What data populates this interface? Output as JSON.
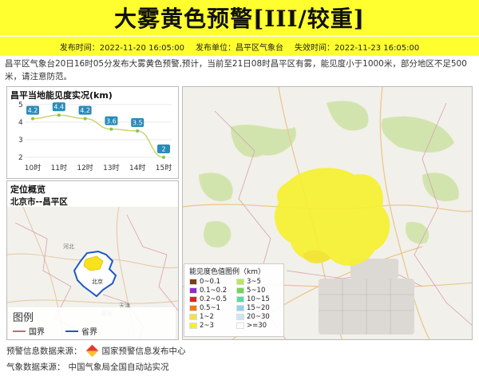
{
  "header": {
    "title": "大雾黄色预警[III/较重]",
    "publish_time": "发布时间：2022-11-20 16:05:00",
    "publisher": "发布单位：昌平区气象台",
    "expire_time": "失效时间：2022-11-23 16:05:00"
  },
  "description": "昌平区气象台20日16时05分发布大雾黄色预警,预计，当前至21日08时昌平区有雾，能见度小于1000米，部分地区不足500米，请注意防范。",
  "chart": {
    "title": "昌平当地能见度实况(km)"
  },
  "chart_data": {
    "type": "line",
    "title": "昌平当地能见度实况(km)",
    "categories": [
      "10时",
      "11时",
      "12时",
      "13时",
      "14时",
      "15时"
    ],
    "values": [
      4.2,
      4.4,
      4.2,
      3.6,
      3.5,
      2
    ],
    "yticks": [
      2,
      3,
      4,
      5
    ],
    "ylim": [
      2,
      5
    ],
    "grid": true,
    "line_color": "#c9d66b",
    "point_color": "#8bc34a",
    "label_bg": "#2a8bb8"
  },
  "location": {
    "title": "定位概览",
    "subtitle": "北京市--昌平区",
    "map_labels": {
      "hebei": "河北",
      "beijing": "北京",
      "tianjin": "天津",
      "langfang": "廊坊"
    }
  },
  "map_legend": {
    "title": "图例",
    "items": [
      {
        "label": "国界",
        "color": "#c46a76"
      },
      {
        "label": "省界",
        "color": "#1d57c9"
      }
    ]
  },
  "visibility_legend": {
    "title": "能见度色值图例（km）",
    "items": [
      {
        "label": "0~0.1",
        "color": "#7b3f14"
      },
      {
        "label": "0.1~0.2",
        "color": "#8e2bd1"
      },
      {
        "label": "0.2~0.5",
        "color": "#e02020"
      },
      {
        "label": "0.5~1",
        "color": "#f07a17"
      },
      {
        "label": "1~2",
        "color": "#f2e24a"
      },
      {
        "label": "2~3",
        "color": "#f5ef2a"
      },
      {
        "label": "3~5",
        "color": "#b7e85b"
      },
      {
        "label": "5~10",
        "color": "#73d35a"
      },
      {
        "label": "10~15",
        "color": "#4fe0a0"
      },
      {
        "label": "15~20",
        "color": "#8fd3f0"
      },
      {
        "label": "20~30",
        "color": "#cfe5f5"
      },
      {
        "label": ">=30",
        "color": "#ffffff"
      }
    ]
  },
  "sources": {
    "warning_label": "预警信息数据来源：",
    "warning_org": "国家预警信息发布中心",
    "weather_label": "气象数据来源：",
    "weather_org": "中国气象局全国自动站实况"
  }
}
